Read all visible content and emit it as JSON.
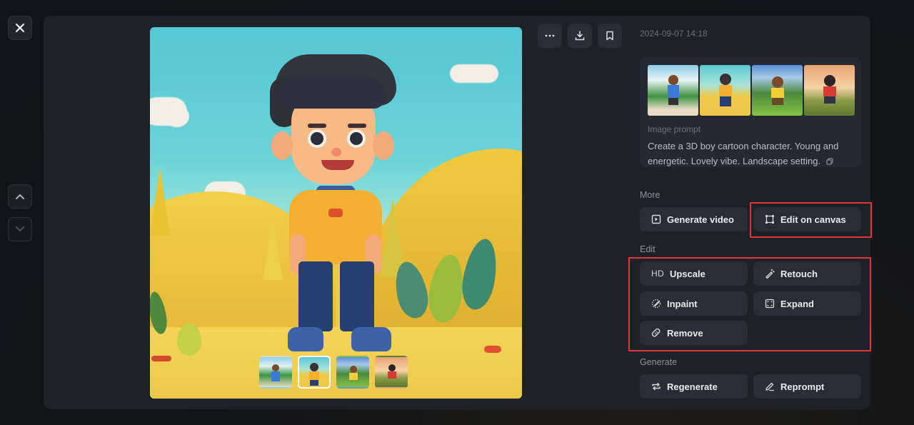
{
  "nav": {
    "close_icon": "close-icon",
    "prev_icon": "chevron-up-icon",
    "next_icon": "chevron-down-icon"
  },
  "viewer": {
    "main_image_alt": "3D cartoon boy in yellow shirt and navy pants standing in a yellow hills landscape",
    "variants": [
      {
        "label": "Variant 1",
        "selected": false
      },
      {
        "label": "Variant 2",
        "selected": true
      },
      {
        "label": "Variant 3",
        "selected": false
      },
      {
        "label": "Variant 4",
        "selected": false
      }
    ],
    "toolbar": [
      {
        "icon": "more-icon",
        "label": "More options"
      },
      {
        "icon": "download-icon",
        "label": "Download"
      },
      {
        "icon": "bookmark-icon",
        "label": "Bookmark"
      }
    ]
  },
  "details": {
    "timestamp": "2024-09-07 14:18",
    "prompt_label": "Image prompt",
    "prompt_text": "Create a 3D boy cartoon character. Young and energetic. Lovely vibe. Landscape setting.",
    "copy_icon": "copy-icon"
  },
  "sections": {
    "more": {
      "label": "More",
      "buttons": [
        {
          "label": "Generate video",
          "icon": "video-add-icon"
        },
        {
          "label": "Edit on canvas",
          "icon": "canvas-icon"
        }
      ]
    },
    "edit": {
      "label": "Edit",
      "buttons": [
        {
          "label": "Upscale",
          "icon": "HD"
        },
        {
          "label": "Retouch",
          "icon": "magic-wand-icon"
        },
        {
          "label": "Inpaint",
          "icon": "brush-icon"
        },
        {
          "label": "Expand",
          "icon": "expand-icon"
        },
        {
          "label": "Remove",
          "icon": "eraser-icon"
        }
      ]
    },
    "generate": {
      "label": "Generate",
      "buttons": [
        {
          "label": "Regenerate",
          "icon": "repeat-icon"
        },
        {
          "label": "Reprompt",
          "icon": "pencil-icon"
        }
      ]
    }
  },
  "highlights": {
    "color": "#e0383a"
  }
}
